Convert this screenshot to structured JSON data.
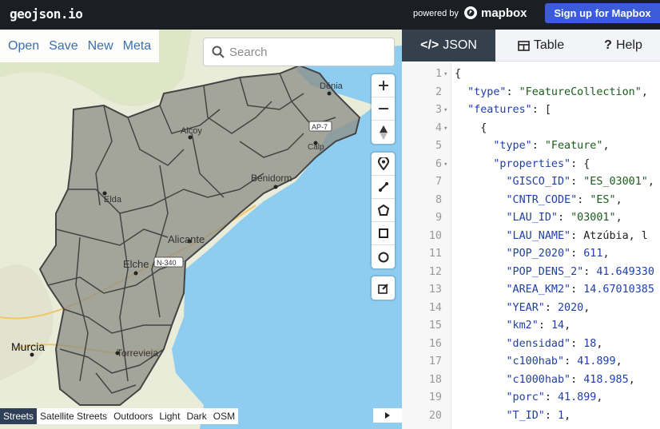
{
  "app": {
    "logo": "geojson.io",
    "powered_by": "powered by",
    "mapbox_label": "mapbox",
    "signup_label": "Sign up for Mapbox"
  },
  "file_menu": [
    "Open",
    "Save",
    "New",
    "Meta"
  ],
  "search": {
    "placeholder": "Search"
  },
  "map_labels": {
    "denia": "Dénia",
    "alcoy": "Alcoy",
    "calp": "Calp",
    "benidorm": "Benidorm",
    "elda": "Elda",
    "alicante": "Alicante",
    "elche": "Elche",
    "n340": "N-340",
    "ap7": "AP-7",
    "murcia": "Murcia",
    "torrevieja": "Torrevieja"
  },
  "map_controls": {
    "zoom": [
      "plus-icon",
      "minus-icon",
      "compass-icon"
    ],
    "draw": [
      "marker-icon",
      "line-icon",
      "polygon-icon",
      "rectangle-icon",
      "circle-icon"
    ],
    "edit": [
      "edit-icon"
    ]
  },
  "styles": [
    "Streets",
    "Satellite Streets",
    "Outdoors",
    "Light",
    "Dark",
    "OSM"
  ],
  "active_style": "Streets",
  "tabs": [
    {
      "label": "JSON",
      "icon": "</>"
    },
    {
      "label": "Table",
      "icon": "table-icon"
    },
    {
      "label": "Help",
      "icon": "?"
    }
  ],
  "code_lines": [
    {
      "n": "1",
      "fold": true,
      "text": "{"
    },
    {
      "n": "2",
      "fold": false,
      "text": "  \"type\": \"FeatureCollection\","
    },
    {
      "n": "3",
      "fold": true,
      "text": "  \"features\": ["
    },
    {
      "n": "4",
      "fold": true,
      "text": "    {"
    },
    {
      "n": "5",
      "fold": false,
      "text": "      \"type\": \"Feature\","
    },
    {
      "n": "6",
      "fold": true,
      "text": "      \"properties\": {"
    },
    {
      "n": "7",
      "fold": false,
      "text": "        \"GISCO_ID\": \"ES_03001\","
    },
    {
      "n": "8",
      "fold": false,
      "text": "        \"CNTR_CODE\": \"ES\","
    },
    {
      "n": "9",
      "fold": false,
      "text": "        \"LAU_ID\": \"03001\","
    },
    {
      "n": "10",
      "fold": false,
      "text": "        \"LAU_NAME\": \"Atzúbia, l"
    },
    {
      "n": "11",
      "fold": false,
      "text": "        \"POP_2020\": 611,"
    },
    {
      "n": "12",
      "fold": false,
      "text": "        \"POP_DENS_2\": 41.649330"
    },
    {
      "n": "13",
      "fold": false,
      "text": "        \"AREA_KM2\": 14.67010385"
    },
    {
      "n": "14",
      "fold": false,
      "text": "        \"YEAR\": 2020,"
    },
    {
      "n": "15",
      "fold": false,
      "text": "        \"km2\": 14,"
    },
    {
      "n": "16",
      "fold": false,
      "text": "        \"densidad\": 18,"
    },
    {
      "n": "17",
      "fold": false,
      "text": "        \"c100hab\": 41.899,"
    },
    {
      "n": "18",
      "fold": false,
      "text": "        \"c1000hab\": 418.985,"
    },
    {
      "n": "19",
      "fold": false,
      "text": "        \"porc\": 41.899,"
    },
    {
      "n": "20",
      "fold": false,
      "text": "        \"T_ID\": 1,"
    }
  ],
  "colors": {
    "topbar": "#1b1f24",
    "signup": "#3b5bdb",
    "active_tab": "#35404d",
    "link": "#3a6fb0",
    "sea": "#8fcdf0",
    "region_fill": "#8e8e86"
  }
}
